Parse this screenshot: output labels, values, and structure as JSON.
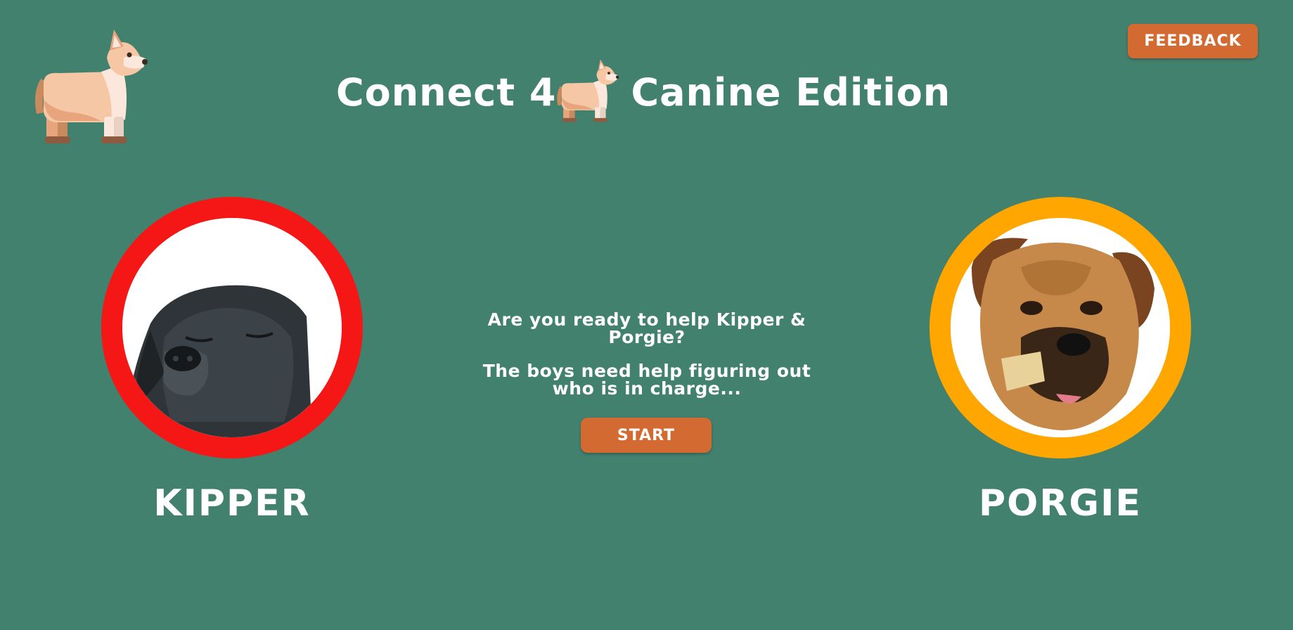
{
  "header": {
    "title_part1": "Connect 4",
    "title_part2": "Canine Edition",
    "logo_icon": "corgi-icon"
  },
  "feedback_button": {
    "label": "FEEDBACK"
  },
  "intro": {
    "line1": "Are you ready to help Kipper &",
    "line2": "Porgie?",
    "line3": "The boys need help figuring out",
    "line4": "who is in charge..."
  },
  "start_button": {
    "label": "START"
  },
  "players": [
    {
      "name": "KIPPER",
      "ring_color": "#f51616"
    },
    {
      "name": "PORGIE",
      "ring_color": "#ffa600"
    }
  ],
  "colors": {
    "background": "#42816d",
    "button": "#d36a32",
    "text": "#ffffff"
  }
}
